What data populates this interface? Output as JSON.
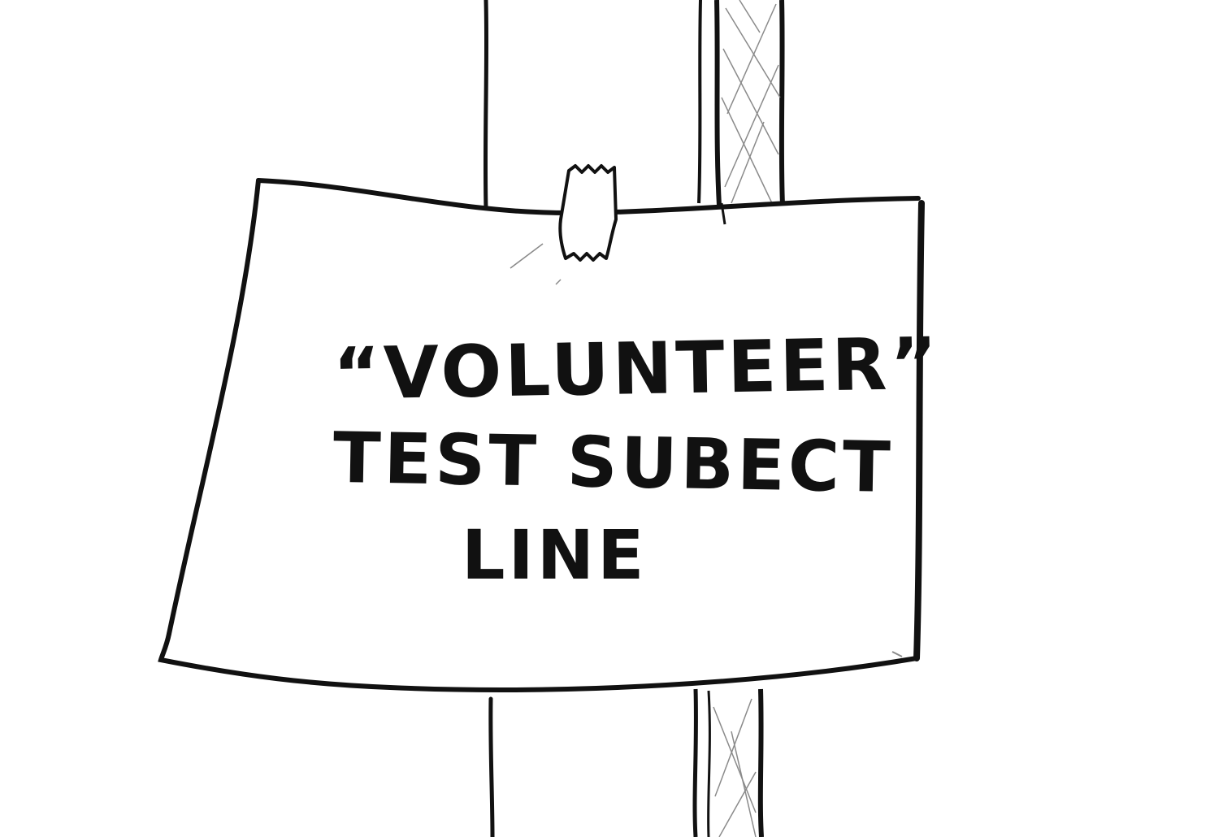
{
  "sign": {
    "line1": "“VOLUNTEER”",
    "line2": "TEST SUBECT",
    "line3": "LINE"
  },
  "colors": {
    "ink": "#111111",
    "paper": "#ffffff",
    "hatch": "#8a8a8a"
  },
  "icons": {
    "tape": "tape-icon"
  }
}
